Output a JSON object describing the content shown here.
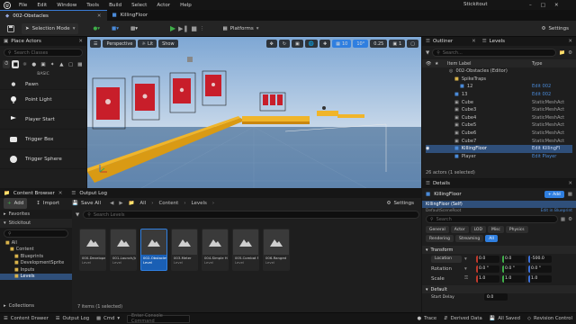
{
  "window": {
    "project": "Stickitout",
    "menus": [
      "File",
      "Edit",
      "Window",
      "Tools",
      "Build",
      "Select",
      "Actor",
      "Help"
    ],
    "level_tab": "002-Obstacles",
    "asset_tab": "KillingFloor"
  },
  "toolbar": {
    "save_icon": "save-icon",
    "selection_mode": "Selection Mode",
    "platforms": "Platforms",
    "settings": "Settings"
  },
  "place_actors": {
    "title": "Place Actors",
    "search_placeholder": "Search Classes",
    "category": "BASIC",
    "items": [
      {
        "label": "Pawn",
        "icon": "pawn-icon"
      },
      {
        "label": "Point Light",
        "icon": "point-light-icon"
      },
      {
        "label": "Player Start",
        "icon": "player-start-icon"
      },
      {
        "label": "Trigger Box",
        "icon": "trigger-box-icon"
      },
      {
        "label": "Trigger Sphere",
        "icon": "trigger-sphere-icon"
      }
    ]
  },
  "viewport": {
    "perspective": "Perspective",
    "lit": "Lit",
    "show": "Show",
    "grid_snap": "10",
    "rot_snap": "10°",
    "scale_snap": "0.25",
    "cam_speed": "1"
  },
  "outliner": {
    "title": "Outliner",
    "levels_tab": "Levels",
    "search_placeholder": "Search...",
    "col_label": "Item Label",
    "col_type": "Type",
    "rows": [
      {
        "label": "002-Obstacles (Editor)",
        "type": "",
        "indent": 1,
        "kind": "world"
      },
      {
        "label": "SpikeTraps",
        "type": "",
        "indent": 2,
        "kind": "folder"
      },
      {
        "label": "12",
        "type": "Edit 002",
        "indent": 3,
        "kind": "actor"
      },
      {
        "label": "13",
        "type": "Edit 002",
        "indent": 2,
        "kind": "actor"
      },
      {
        "label": "Cube",
        "type": "StaticMeshAct",
        "indent": 2,
        "kind": "mesh"
      },
      {
        "label": "Cube3",
        "type": "StaticMeshAct",
        "indent": 2,
        "kind": "mesh"
      },
      {
        "label": "Cube4",
        "type": "StaticMeshAct",
        "indent": 2,
        "kind": "mesh"
      },
      {
        "label": "Cube5",
        "type": "StaticMeshAct",
        "indent": 2,
        "kind": "mesh"
      },
      {
        "label": "Cube6",
        "type": "StaticMeshAct",
        "indent": 2,
        "kind": "mesh"
      },
      {
        "label": "Cube7",
        "type": "StaticMeshAct",
        "indent": 2,
        "kind": "mesh"
      },
      {
        "label": "KillingFloor",
        "type": "Edit KillingFl",
        "indent": 2,
        "kind": "actor",
        "selected": true
      },
      {
        "label": "Player",
        "type": "Edit Player",
        "indent": 2,
        "kind": "actor"
      }
    ],
    "status": "26 actors (1 selected)"
  },
  "details": {
    "title": "Details",
    "actor_name": "KillingFloor",
    "add_label": "+ Add",
    "self_label": "KillingFloor (Self)",
    "edit_in_blueprint": "Edit in Blueprint",
    "default_scene_root": "DefaultSceneRoot",
    "search_placeholder": "Search",
    "filters_row1": [
      "General",
      "Actor",
      "LOD",
      "Misc",
      "Physics"
    ],
    "filters_row2": [
      "Rendering",
      "Streaming",
      "All"
    ],
    "active_filter": "All",
    "transform_section": "Transform",
    "location_label": "Location",
    "rotation_label": "Rotation",
    "scale_label": "Scale",
    "location": [
      "0.0",
      "0.0",
      "-500.0"
    ],
    "rotation": [
      "0.0 °",
      "0.0 °",
      "0.0 °"
    ],
    "scale": [
      "1.0",
      "1.0",
      "1.0"
    ],
    "default_section": "Default",
    "start_delay_label": "Start Delay",
    "start_delay": "0.0"
  },
  "content_browser": {
    "title": "Content Browser",
    "output_log_tab": "Output Log",
    "add": "Add",
    "import": "Import",
    "save_all": "Save All",
    "settings": "Settings",
    "breadcrumb": [
      "All",
      "Content",
      "Levels"
    ],
    "favorites": "Favorites",
    "root": "Stickitout",
    "tree": [
      {
        "label": "All",
        "indent": 0
      },
      {
        "label": "Content",
        "indent": 1
      },
      {
        "label": "Blueprints",
        "indent": 2
      },
      {
        "label": "DevelopmentSprite",
        "indent": 2
      },
      {
        "label": "Inputs",
        "indent": 2
      },
      {
        "label": "Levels",
        "indent": 2,
        "selected": true
      }
    ],
    "search_placeholder": "Search Levels",
    "assets": [
      {
        "name": "000-Developer",
        "type": "Level"
      },
      {
        "name": "001-Launch/Ju",
        "type": "Level"
      },
      {
        "name": "002-Obstacles",
        "type": "Level",
        "selected": true
      },
      {
        "name": "003-Meter",
        "type": "Level"
      },
      {
        "name": "004-Simple Ho",
        "type": "Level"
      },
      {
        "name": "005-Combat Pl",
        "type": "Level"
      },
      {
        "name": "006-Ranged",
        "type": "Level"
      }
    ],
    "item_count": "7 items (1 selected)",
    "collections": "Collections"
  },
  "status_bar": {
    "content_drawer": "Content Drawer",
    "output_log": "Output Log",
    "cmd": "Cmd",
    "console_placeholder": "Enter Console Command",
    "trace": "Trace",
    "derived_data": "Derived Data",
    "all_saved": "All Saved",
    "revision_control": "Revision Control"
  },
  "colors": {
    "accent": "#2f7fe0",
    "play_green": "#3fae49",
    "platform_orange": "#e8a21a",
    "banner_red": "#c81e2a",
    "sky": "#8fb4dc"
  }
}
